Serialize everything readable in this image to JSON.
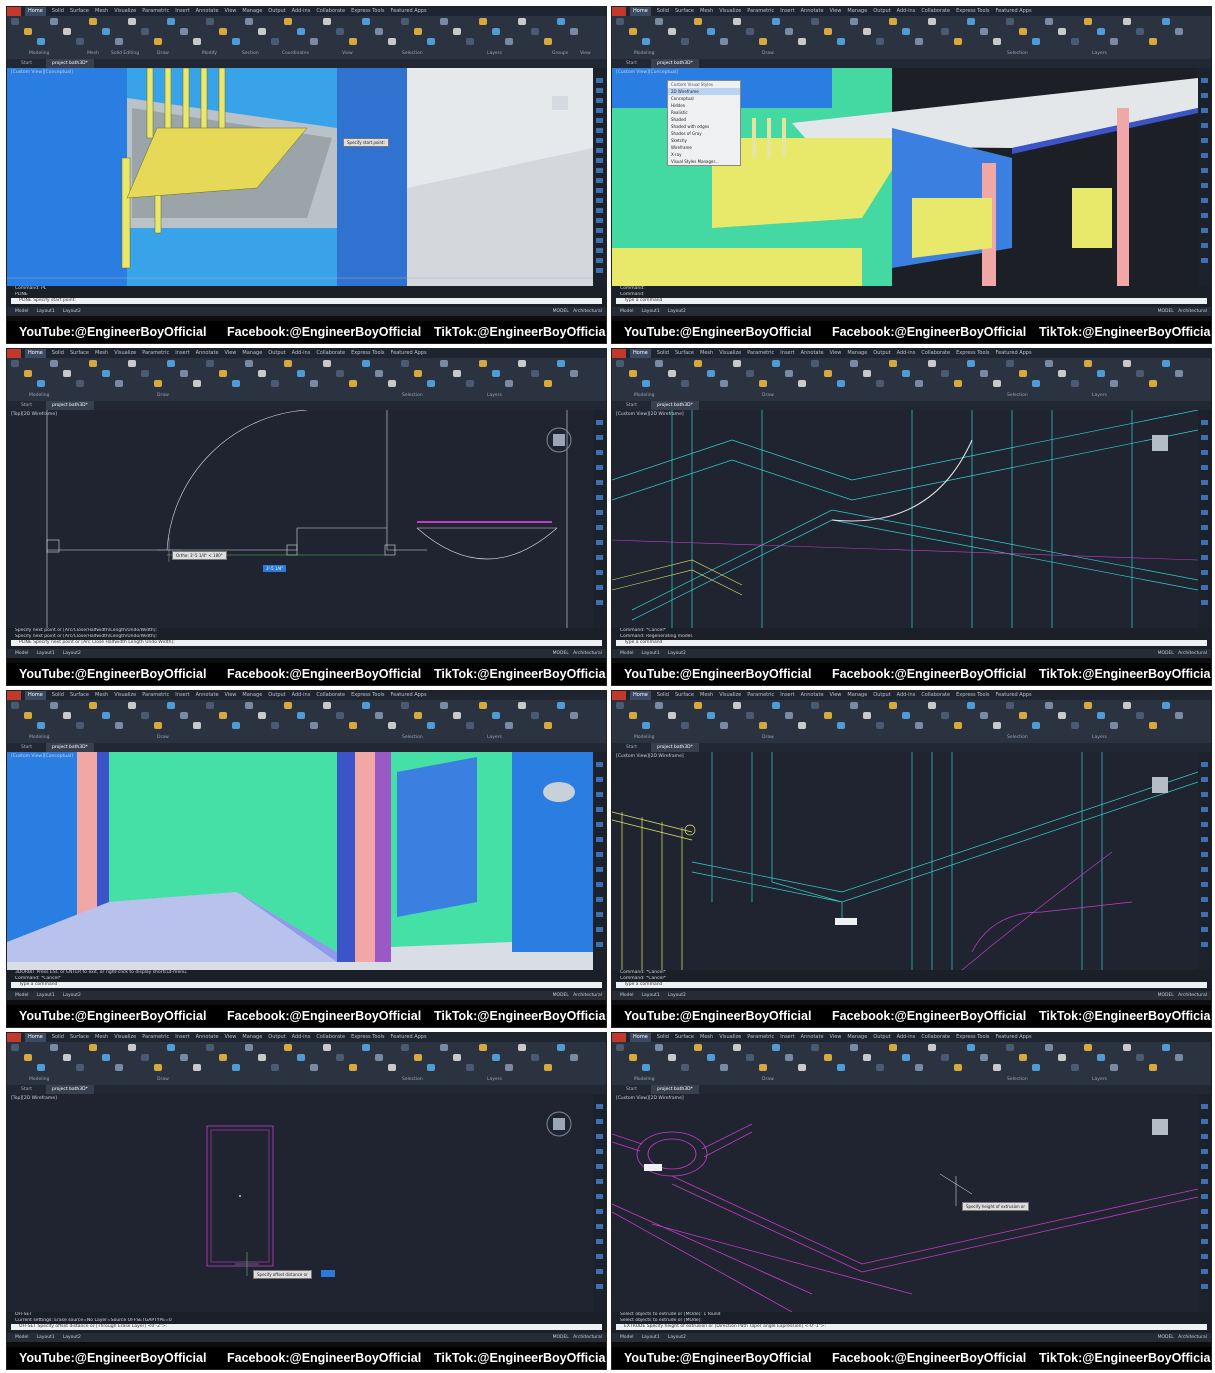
{
  "ribbon": {
    "tabs": [
      "Home",
      "Solid",
      "Surface",
      "Mesh",
      "Visualize",
      "Parametric",
      "Insert",
      "Annotate",
      "View",
      "Manage",
      "Output",
      "Add-ins",
      "Collaborate",
      "Express Tools",
      "Featured Apps"
    ],
    "groups": [
      "Modeling",
      "Mesh",
      "Solid Editing",
      "Draw",
      "Modify",
      "Section",
      "Coordinates",
      "View",
      "Selection",
      "Layers",
      "Groups",
      "View"
    ]
  },
  "file_tabs": {
    "start": "Start",
    "project": "project bath3D*"
  },
  "layout_tabs": {
    "model": "Model",
    "layout1": "Layout1",
    "layout2": "Layout2"
  },
  "status_bar": {
    "model_label": "MODEL",
    "units": "Architectural"
  },
  "credits": {
    "youtube": "YouTube:@EngineerBoyOfficial",
    "facebook": "Facebook:@EngineerBoyOfficial",
    "tiktok": "TikTok:@EngineerBoyOfficial"
  },
  "panels": [
    {
      "viewport_label": "[Custom View][Conceptual]",
      "cmd_lines": [
        "Command: PL",
        "PLINE"
      ],
      "cmd_input": "PLINE Specify start point:",
      "tooltip": "Specify start point:"
    },
    {
      "viewport_label": "[Custom View][Conceptual]",
      "cmd_lines": [
        "Command:",
        "Command:"
      ],
      "cmd_input": "Type a command",
      "menu": {
        "title": "Custom Visual Styles",
        "items": [
          "2D Wireframe",
          "Conceptual",
          "Hidden",
          "Realistic",
          "Shaded",
          "Shaded with edges",
          "Shades of Gray",
          "Sketchy",
          "Wireframe",
          "X-ray",
          "Visual Styles Manager..."
        ]
      }
    },
    {
      "viewport_label": "[Top][2D Wireframe]",
      "cmd_lines": [
        "Specify next point or [Arc/Close/Halfwidth/Length/Undo/Width]:",
        "Specify next point or [Arc/Close/Halfwidth/Length/Undo/Width]:"
      ],
      "cmd_input": "PLINE Specify next point or [Arc Close Halfwidth Length Undo Width]:",
      "tooltip": "Ortho: 3'-5 1/4\" < 180°",
      "input_value": "3'-5 1/4\""
    },
    {
      "viewport_label": "[Custom View][2D Wireframe]",
      "cmd_lines": [
        "Command: *Cancel*",
        "Command:  Regenerating model."
      ],
      "cmd_input": "Type a command"
    },
    {
      "viewport_label": "[Custom View][Conceptual]",
      "cmd_lines": [
        "3DORBIT Press ESC or ENTER to exit, or right-click to display shortcut-menu.",
        "Command: *Cancel*"
      ],
      "cmd_input": "Type a command"
    },
    {
      "viewport_label": "[Custom View][2D Wireframe]",
      "cmd_lines": [
        "Command: *Cancel*",
        "Command: *Cancel*"
      ],
      "cmd_input": "Type a command"
    },
    {
      "viewport_label": "[Top][2D Wireframe]",
      "cmd_lines": [
        "OFFSET",
        "Current settings: Erase source=No  Layer=Source  OFFSETGAPTYPE=0"
      ],
      "cmd_input": "OFFSET Specify offset distance or [Through Erase Layer] <0'-2\">:",
      "tooltip": "Specify offset distance or"
    },
    {
      "viewport_label": "[Custom View][2D Wireframe]",
      "cmd_lines": [
        "Select objects to extrude or [MOde]: 1 found",
        "Select objects to extrude or [MOde]:"
      ],
      "cmd_input": "EXTRUDE Specify height of extrusion or [Direction Path Taper angle Expression] <-0'-1\">:",
      "tooltip": "Specify height of extrusion or"
    }
  ],
  "colors": {
    "ribbon": "#2b3240",
    "viewport_dark": "#1a1f2b",
    "accent": "#3d6fb1",
    "conceptual_blue": "#2a7de1",
    "conceptual_green": "#4fe3a6",
    "conceptual_yellow": "#e8e86a",
    "magenta": "#c33cc6"
  }
}
